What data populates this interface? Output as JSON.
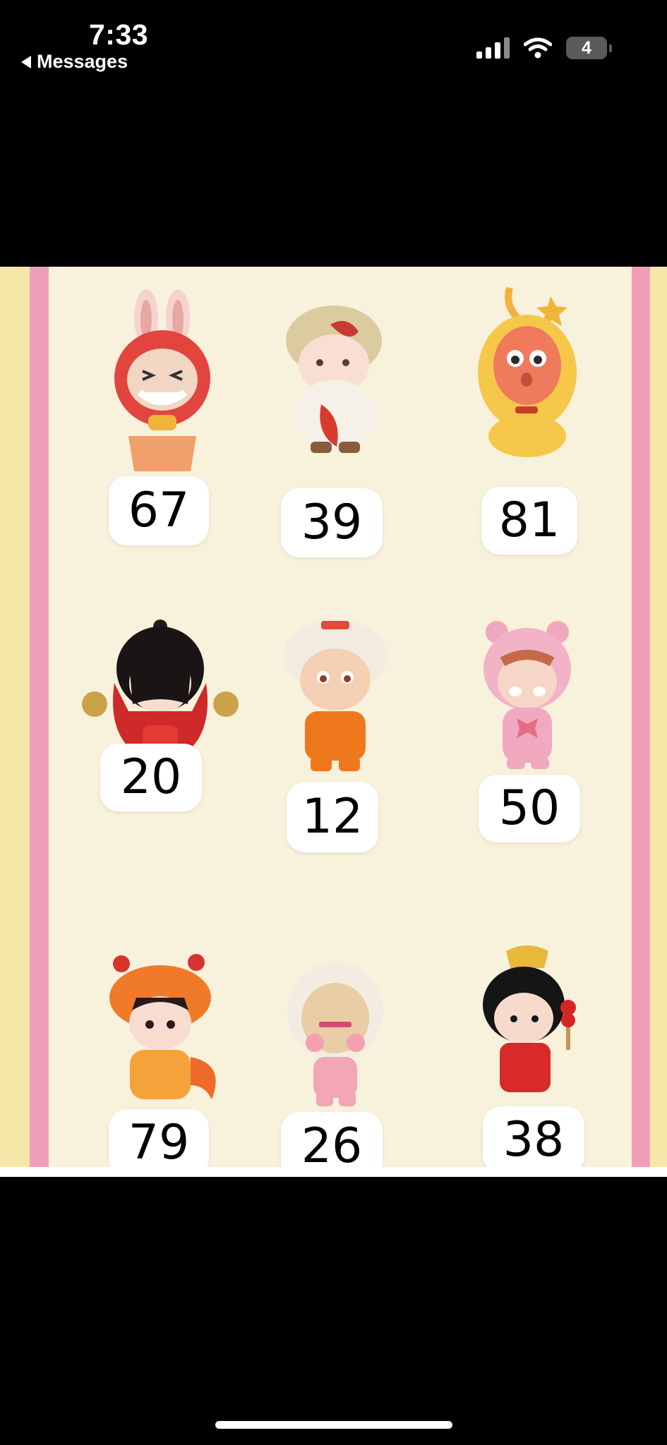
{
  "status_bar": {
    "time": "7:33",
    "back_label": "Messages",
    "battery_level": "4"
  },
  "figures": [
    {
      "number": "67",
      "character": "red furry rabbit-eared figure with gold ingot"
    },
    {
      "number": "39",
      "character": "cream figure holding red fish"
    },
    {
      "number": "81",
      "character": "orange figure in yellow hood"
    },
    {
      "number": "20",
      "character": "black-haired figure in red cape with gold coins"
    },
    {
      "number": "12",
      "character": "lion dance headdress figure in orange"
    },
    {
      "number": "50",
      "character": "pink bear costume figure"
    },
    {
      "number": "79",
      "character": "orange dragon costume figure"
    },
    {
      "number": "26",
      "character": "white-hooded figure in pink"
    },
    {
      "number": "38",
      "character": "black-haired boy in red holding candied fruit"
    }
  ],
  "colors": {
    "panel": "#f8f1dc",
    "pink_border": "#ef9fb8",
    "yellow_edge": "#f6e7a8"
  }
}
